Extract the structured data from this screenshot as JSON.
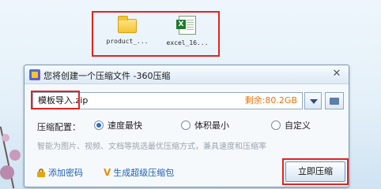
{
  "desktop": {
    "icons": [
      {
        "icon": "folder-icon",
        "label": "product_..."
      },
      {
        "icon": "excel-file-icon",
        "label": "excel_16..."
      }
    ]
  },
  "dialog": {
    "title": "您将创建一个压缩文件 -360压缩",
    "close_glyph": "✕",
    "filename": {
      "name": "模板导入",
      "ext": ".zip",
      "free_space": "剩余:80.2GB"
    },
    "compression_label": "压缩配置：",
    "options": [
      {
        "label": "速度最快",
        "selected": true
      },
      {
        "label": "体积最小",
        "selected": false
      },
      {
        "label": "自定义",
        "selected": false
      }
    ],
    "hint": "智能为图片、视频、文档等挑选最优压缩方式，兼具速度和压缩率",
    "add_password": "添加密码",
    "self_extract": "生成超级压缩包",
    "compress_button": "立即压缩"
  },
  "colors": {
    "highlight": "#e32222",
    "accent": "#2a6fc9",
    "free_space": "#e8740c",
    "link": "#1a5fb4"
  }
}
